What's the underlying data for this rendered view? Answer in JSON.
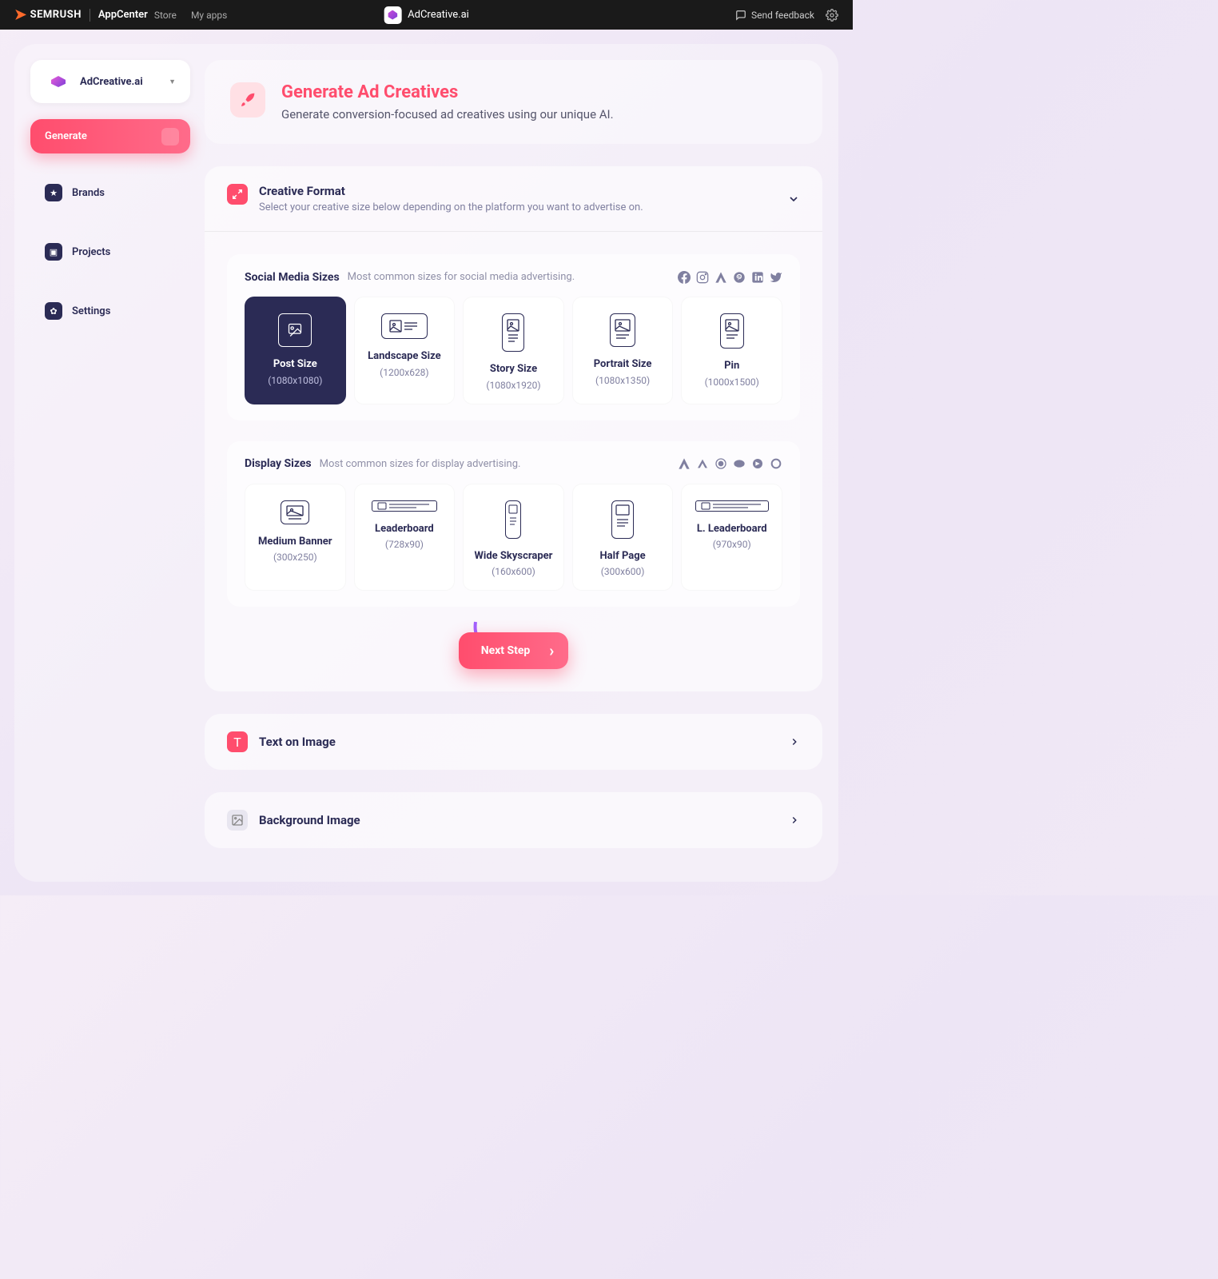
{
  "topbar": {
    "brand": "SEMRUSH",
    "app_center": "AppCenter",
    "links": {
      "store": "Store",
      "myapps": "My apps"
    },
    "center_app": "AdCreative.ai",
    "feedback": "Send feedback"
  },
  "sidebar": {
    "app_name": "AdCreative.ai",
    "items": [
      {
        "label": "Generate"
      },
      {
        "label": "Brands"
      },
      {
        "label": "Projects"
      },
      {
        "label": "Settings"
      }
    ]
  },
  "hero": {
    "title": "Generate Ad Creatives",
    "subtitle": "Generate conversion-focused ad creatives using our unique AI."
  },
  "format_panel": {
    "title": "Creative Format",
    "subtitle": "Select your creative size below depending on the platform you want to advertise on."
  },
  "social_section": {
    "title": "Social Media Sizes",
    "subtitle": "Most common sizes for social media advertising.",
    "cards": [
      {
        "name": "Post Size",
        "dim": "(1080x1080)"
      },
      {
        "name": "Landscape Size",
        "dim": "(1200x628)"
      },
      {
        "name": "Story Size",
        "dim": "(1080x1920)"
      },
      {
        "name": "Portrait Size",
        "dim": "(1080x1350)"
      },
      {
        "name": "Pin",
        "dim": "(1000x1500)"
      }
    ]
  },
  "display_section": {
    "title": "Display Sizes",
    "subtitle": "Most common sizes for display advertising.",
    "cards": [
      {
        "name": "Medium Banner",
        "dim": "(300x250)"
      },
      {
        "name": "Leaderboard",
        "dim": "(728x90)"
      },
      {
        "name": "Wide Skyscraper",
        "dim": "(160x600)"
      },
      {
        "name": "Half Page",
        "dim": "(300x600)"
      },
      {
        "name": "L. Leaderboard",
        "dim": "(970x90)"
      }
    ]
  },
  "next_button": "Next Step",
  "collapsed_panels": {
    "text": "Text on Image",
    "background": "Background Image"
  }
}
